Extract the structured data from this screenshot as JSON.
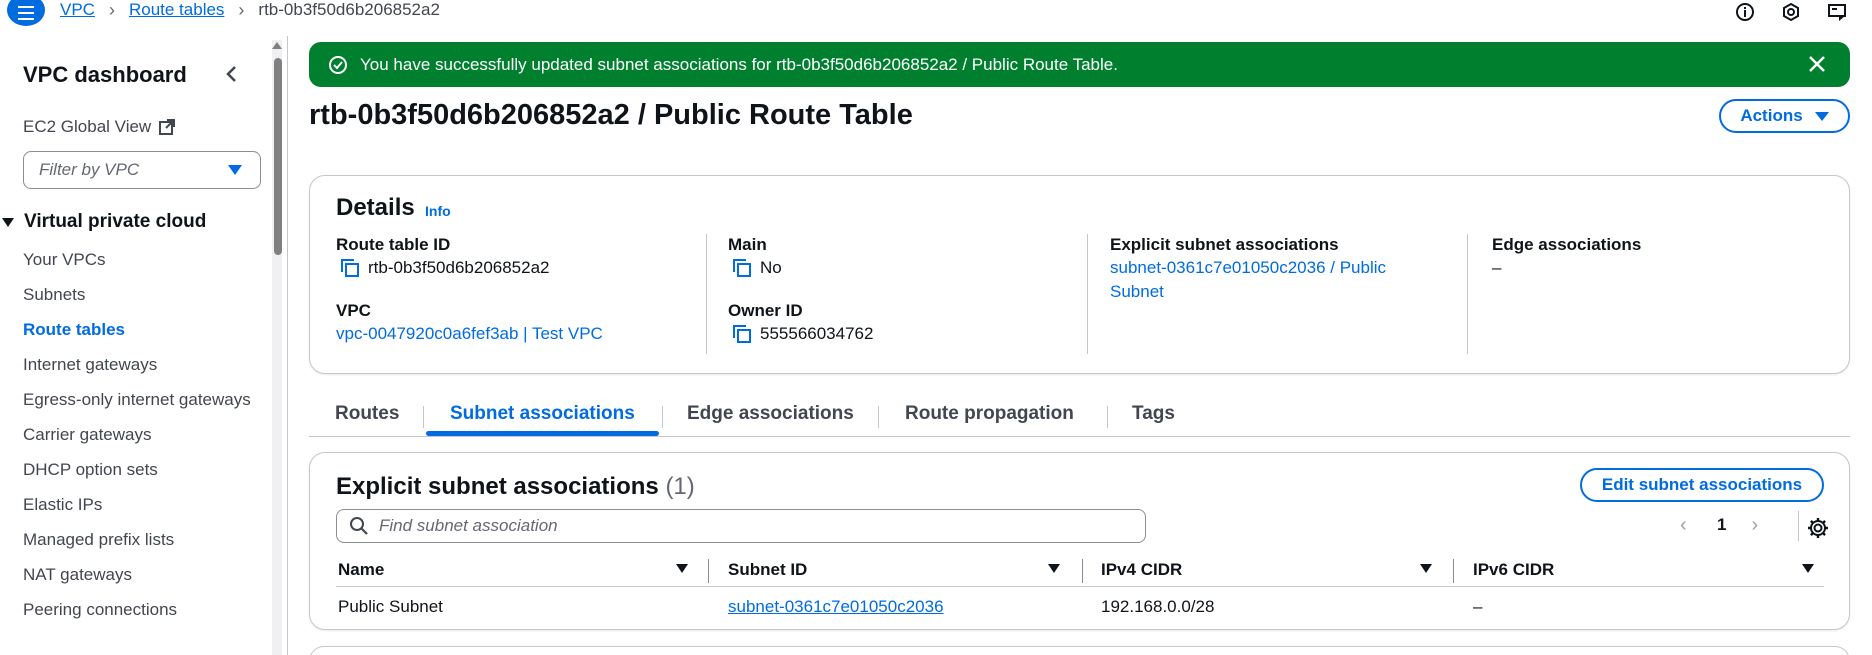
{
  "breadcrumb": {
    "items": [
      "VPC",
      "Route tables"
    ],
    "current": "rtb-0b3f50d6b206852a2"
  },
  "sidebar": {
    "title": "VPC dashboard",
    "ec2_global_view": "EC2 Global View",
    "filter_placeholder": "Filter by VPC",
    "section": "Virtual private cloud",
    "items": [
      {
        "label": "Your VPCs"
      },
      {
        "label": "Subnets"
      },
      {
        "label": "Route tables"
      },
      {
        "label": "Internet gateways"
      },
      {
        "label": "Egress-only internet gateways"
      },
      {
        "label": "Carrier gateways"
      },
      {
        "label": "DHCP option sets"
      },
      {
        "label": "Elastic IPs"
      },
      {
        "label": "Managed prefix lists"
      },
      {
        "label": "NAT gateways"
      },
      {
        "label": "Peering connections"
      }
    ]
  },
  "flash": {
    "message": "You have successfully updated subnet associations for rtb-0b3f50d6b206852a2 / Public Route Table."
  },
  "header": {
    "title": "rtb-0b3f50d6b206852a2 / Public Route Table",
    "actions_label": "Actions"
  },
  "details": {
    "heading": "Details",
    "info": "Info",
    "route_table_id_label": "Route table ID",
    "route_table_id": "rtb-0b3f50d6b206852a2",
    "vpc_label": "VPC",
    "vpc_value": "vpc-0047920c0a6fef3ab | Test VPC",
    "main_label": "Main",
    "main_value": "No",
    "owner_label": "Owner ID",
    "owner_value": "555566034762",
    "explicit_label": "Explicit subnet associations",
    "explicit_value_line1": "subnet-0361c7e01050c2036 / Public",
    "explicit_value_line2": "Subnet",
    "edge_label": "Edge associations",
    "edge_value": "–"
  },
  "tabs": [
    {
      "label": "Routes"
    },
    {
      "label": "Subnet associations"
    },
    {
      "label": "Edge associations"
    },
    {
      "label": "Route propagation"
    },
    {
      "label": "Tags"
    }
  ],
  "subnet_assoc": {
    "heading": "Explicit subnet associations",
    "count": "(1)",
    "edit_label": "Edit subnet associations",
    "search_placeholder": "Find subnet association",
    "page": "1",
    "columns": [
      "Name",
      "Subnet ID",
      "IPv4 CIDR",
      "IPv6 CIDR"
    ],
    "rows": [
      {
        "name": "Public Subnet",
        "subnet_id": "subnet-0361c7e01050c2036",
        "ipv4": "192.168.0.0/28",
        "ipv6": "–"
      }
    ]
  },
  "colors": {
    "accent": "#006ce0",
    "success": "#00802f",
    "text": "#0f141a",
    "muted": "#424650"
  }
}
